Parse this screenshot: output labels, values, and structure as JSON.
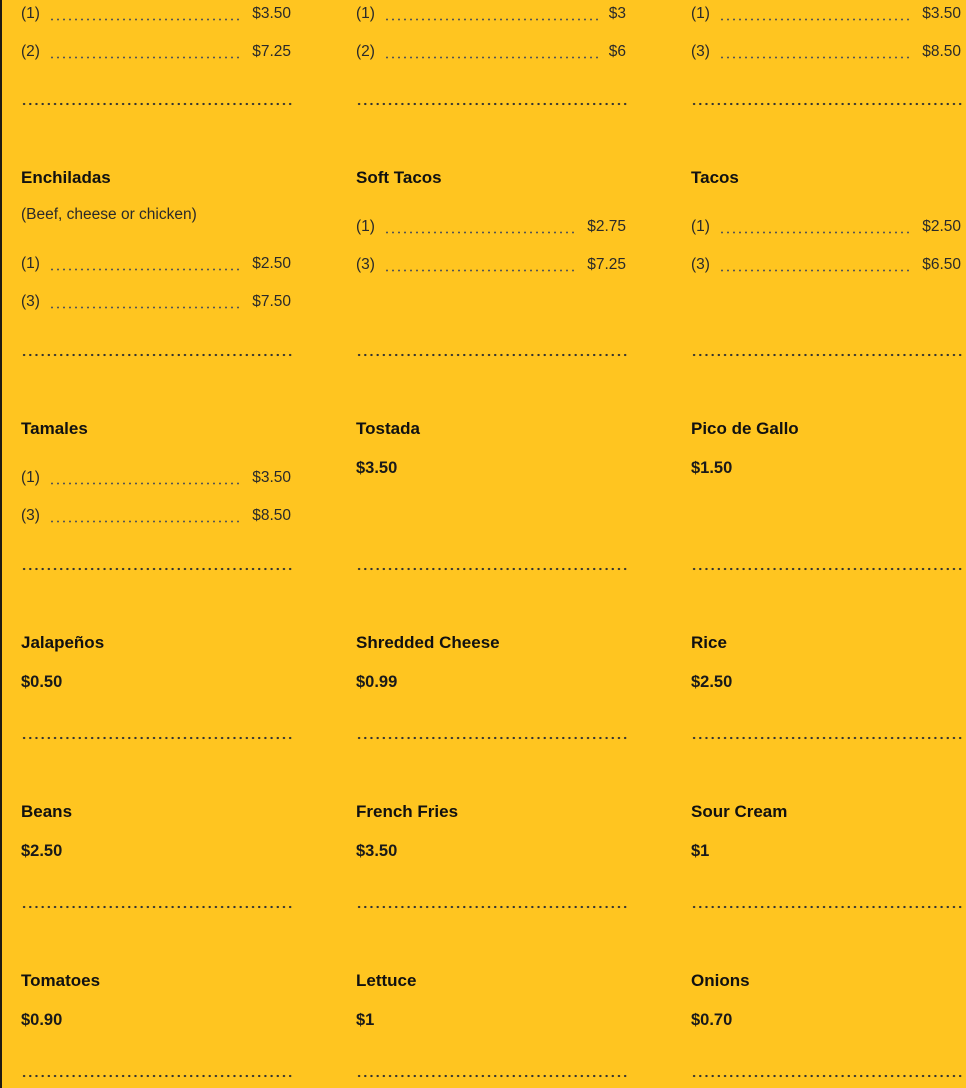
{
  "menu": {
    "row0": {
      "col0": {
        "rows": [
          {
            "qty": "(1)",
            "price": "$3.50"
          },
          {
            "qty": "(2)",
            "price": "$7.25"
          }
        ]
      },
      "col1": {
        "rows": [
          {
            "qty": "(1)",
            "price": "$3"
          },
          {
            "qty": "(2)",
            "price": "$6"
          }
        ]
      },
      "col2": {
        "rows": [
          {
            "qty": "(1)",
            "price": "$3.50"
          },
          {
            "qty": "(3)",
            "price": "$8.50"
          }
        ]
      }
    },
    "row1": {
      "col0": {
        "name": "Enchiladas",
        "note": "(Beef, cheese or chicken)",
        "rows": [
          {
            "qty": "(1)",
            "price": "$2.50"
          },
          {
            "qty": "(3)",
            "price": "$7.50"
          }
        ]
      },
      "col1": {
        "name": "Soft Tacos",
        "rows": [
          {
            "qty": "(1)",
            "price": "$2.75"
          },
          {
            "qty": "(3)",
            "price": "$7.25"
          }
        ]
      },
      "col2": {
        "name": "Tacos",
        "rows": [
          {
            "qty": "(1)",
            "price": "$2.50"
          },
          {
            "qty": "(3)",
            "price": "$6.50"
          }
        ]
      }
    },
    "row2": {
      "col0": {
        "name": "Tamales",
        "rows": [
          {
            "qty": "(1)",
            "price": "$3.50"
          },
          {
            "qty": "(3)",
            "price": "$8.50"
          }
        ]
      },
      "col1": {
        "name": "Tostada",
        "price": "$3.50"
      },
      "col2": {
        "name": "Pico de Gallo",
        "price": "$1.50"
      }
    },
    "row3": {
      "col0": {
        "name": "Jalapeños",
        "price": "$0.50"
      },
      "col1": {
        "name": "Shredded Cheese",
        "price": "$0.99"
      },
      "col2": {
        "name": "Rice",
        "price": "$2.50"
      }
    },
    "row4": {
      "col0": {
        "name": "Beans",
        "price": "$2.50"
      },
      "col1": {
        "name": "French Fries",
        "price": "$3.50"
      },
      "col2": {
        "name": "Sour Cream",
        "price": "$1"
      }
    },
    "row5": {
      "col0": {
        "name": "Tomatoes",
        "price": "$0.90"
      },
      "col1": {
        "name": "Lettuce",
        "price": "$1"
      },
      "col2": {
        "name": "Onions",
        "price": "$0.70"
      }
    }
  },
  "colors": {
    "background": "#ffc520",
    "text": "#1a1a1a"
  }
}
